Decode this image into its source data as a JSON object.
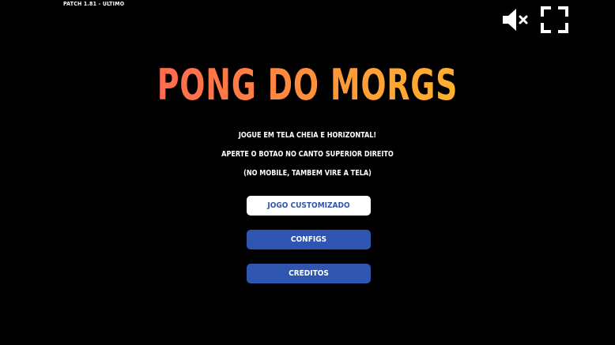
{
  "patch_label": "PATCH 1.81 - ULTIMO",
  "title": "PONG DO MORGS",
  "instructions": [
    "JOGUE EM TELA CHEIA E HORIZONTAL!",
    "APERTE O BOTAO NO CANTO SUPERIOR DIREITO",
    "(NO MOBILE, TAMBEM VIRE A TELA)"
  ],
  "menu": {
    "custom_game_label": "JOGO CUSTOMIZADO",
    "configs_label": "CONFIGS",
    "credits_label": "CREDITOS"
  },
  "icons": {
    "mute": "speaker-muted-icon",
    "fullscreen": "fullscreen-icon"
  },
  "colors": {
    "background": "#000000",
    "title_gradient_start": "#ff5a5a",
    "title_gradient_end": "#ffc226",
    "button_blue": "#2f55b0",
    "button_white": "#ffffff"
  }
}
